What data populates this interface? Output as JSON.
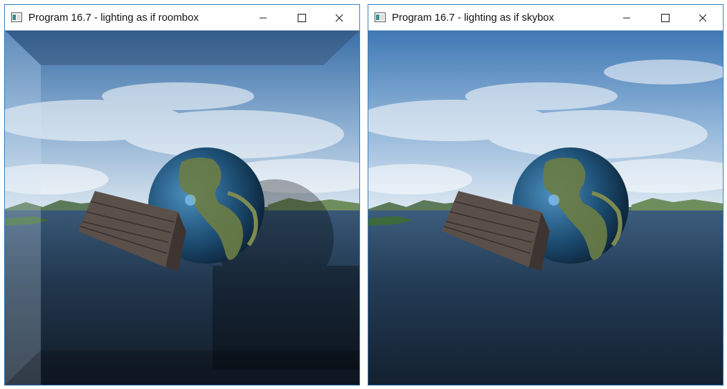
{
  "windows": [
    {
      "id": "left",
      "title": "Program 16.7 - lighting as if roombox",
      "controls": {
        "minimize_icon": "minimize-icon",
        "maximize_icon": "maximize-icon",
        "close_icon": "close-icon"
      }
    },
    {
      "id": "right",
      "title": "Program 16.7 - lighting as if skybox",
      "controls": {
        "minimize_icon": "minimize-icon",
        "maximize_icon": "maximize-icon",
        "close_icon": "close-icon"
      }
    }
  ],
  "colors": {
    "window_border": "#2f80c7",
    "title_text": "#111111",
    "sky": "#4f7fb3",
    "sea": "#1e3550"
  }
}
